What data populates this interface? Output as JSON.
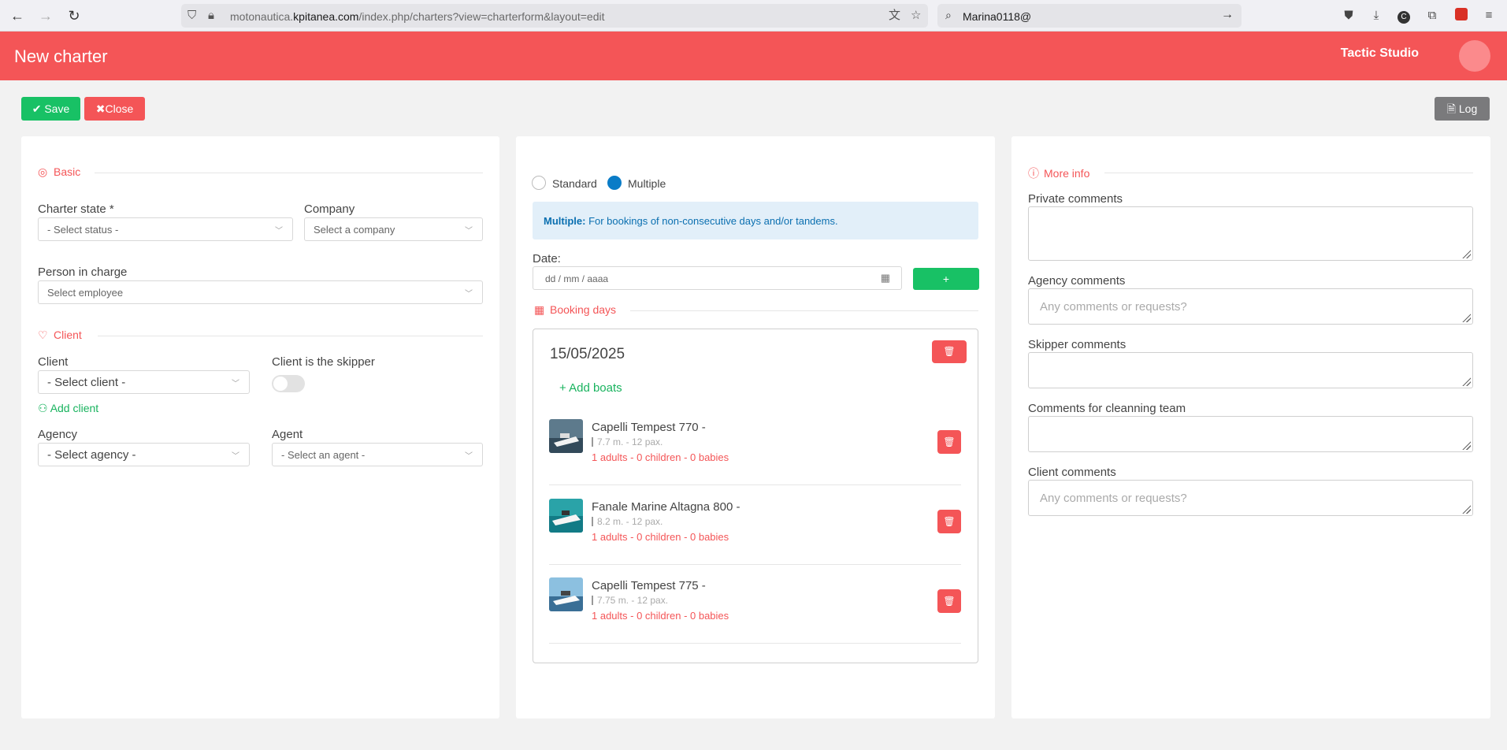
{
  "browser": {
    "url_prefix": "motonautica.",
    "url_domain": "kpitanea.com",
    "url_path": "/index.php/charters?view=charterform&layout=edit",
    "search_text": "Marina0118@"
  },
  "header": {
    "title": "New charter",
    "studio": "Tactic Studio"
  },
  "toolbar": {
    "save_label": "Save",
    "close_label": "Close",
    "log_label": "Log"
  },
  "basic": {
    "section_title": "Basic",
    "charter_state_label": "Charter state *",
    "charter_state_value": "- Select status -",
    "company_label": "Company",
    "company_value": "Select a company",
    "person_label": "Person in charge",
    "person_value": "Select employee"
  },
  "client": {
    "section_title": "Client",
    "client_label": "Client",
    "client_value": "- Select client -",
    "skipper_label": "Client is the skipper",
    "skipper_on": false,
    "add_client_label": "Add client",
    "agency_label": "Agency",
    "agency_value": "- Select agency -",
    "agent_label": "Agent",
    "agent_value": "- Select an agent -"
  },
  "booking": {
    "mode_standard": "Standard",
    "mode_multiple": "Multiple",
    "selected_mode": "Multiple",
    "info_bold": "Multiple:",
    "info_text": "For bookings of non-consecutive days and/or tandems.",
    "date_label": "Date:",
    "date_placeholder": "dd / mm / aaaa",
    "add_label": "+",
    "days_title": "Booking days",
    "day_date": "15/05/2025",
    "add_boats_label": "Add boats",
    "boats": [
      {
        "name": "Capelli Tempest 770 -",
        "spec": "7.7 m. - 12 pax.",
        "pax": "1 adults - 0 children - 0 babies"
      },
      {
        "name": "Fanale Marine Altagna 800 -",
        "spec": "8.2 m. - 12 pax.",
        "pax": "1 adults - 0 children - 0 babies"
      },
      {
        "name": "Capelli Tempest 775 -",
        "spec": "7.75 m. - 12 pax.",
        "pax": "1 adults - 0 children - 0 babies"
      }
    ]
  },
  "more_info": {
    "section_title": "More info",
    "private_label": "Private comments",
    "agency_label": "Agency comments",
    "agency_placeholder": "Any comments or requests?",
    "skipper_label": "Skipper comments",
    "cleaning_label": "Comments for cleanning team",
    "client_label": "Client comments",
    "client_placeholder": "Any comments or requests?"
  },
  "colors": {
    "brand": "#f45557",
    "success": "#18c165",
    "info": "#0a7cc7"
  }
}
